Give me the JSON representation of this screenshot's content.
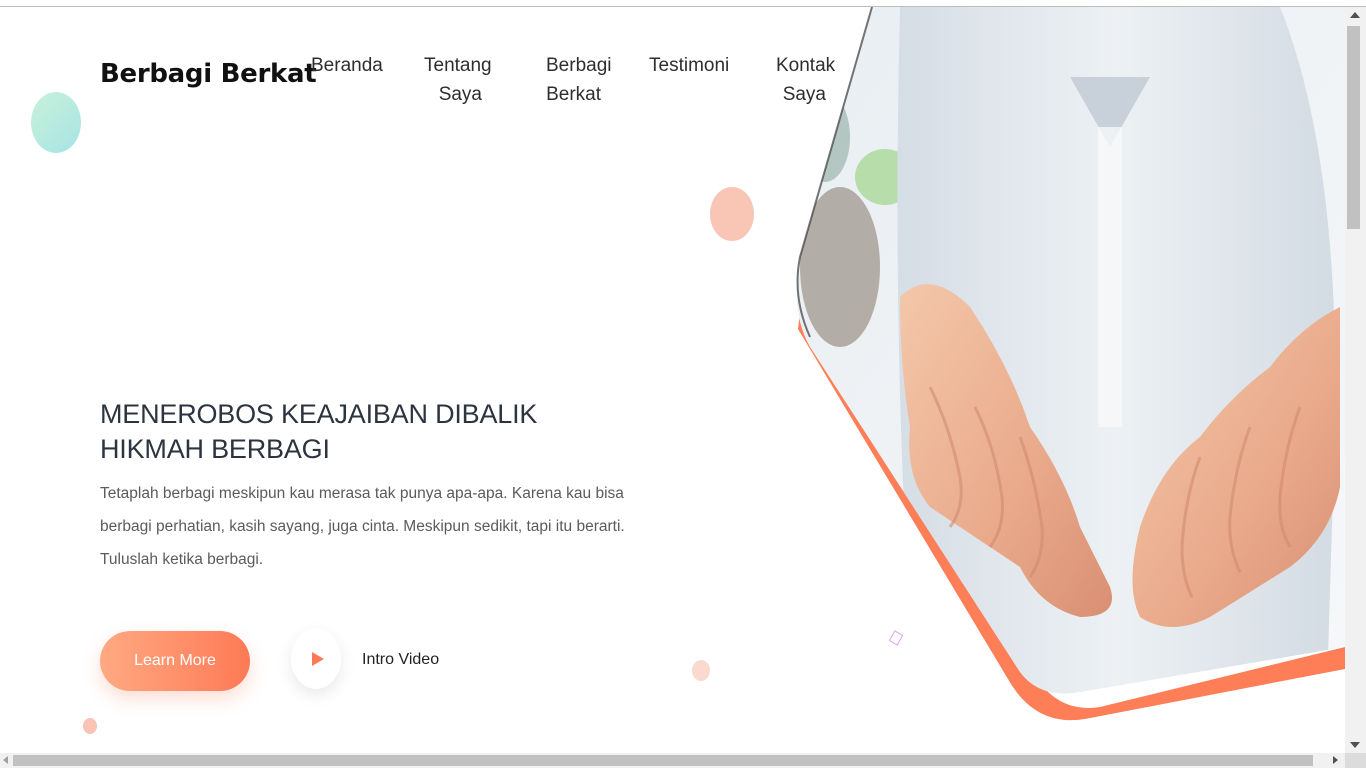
{
  "brand": {
    "logo_text": "Berbagi Berkat"
  },
  "nav": {
    "items": [
      {
        "label": "Beranda"
      },
      {
        "label": "Tentang\nSaya"
      },
      {
        "label": "Berbagi\nBerkat"
      },
      {
        "label": "Testimoni"
      },
      {
        "label": "Kontak\nSaya"
      }
    ]
  },
  "hero": {
    "title": "MENEROBOS KEAJAIBAN DIBALIK HIKMAH BERBAGI",
    "description": "Tetaplah berbagi meskipun kau merasa tak punya apa-apa. Karena kau bisa berbagi perhatian, kasih sayang, juga cinta. Meskipun sedikit, tapi itu berarti. Tuluslah ketika berbagi.",
    "learn_more_label": "Learn More",
    "intro_video_label": "Intro Video"
  },
  "colors": {
    "accent": "#fd7a55",
    "accent_light": "#ffa983",
    "title_text": "#2c3440",
    "body_text": "#5b5b5b"
  },
  "icons": {
    "play": "play-icon"
  }
}
